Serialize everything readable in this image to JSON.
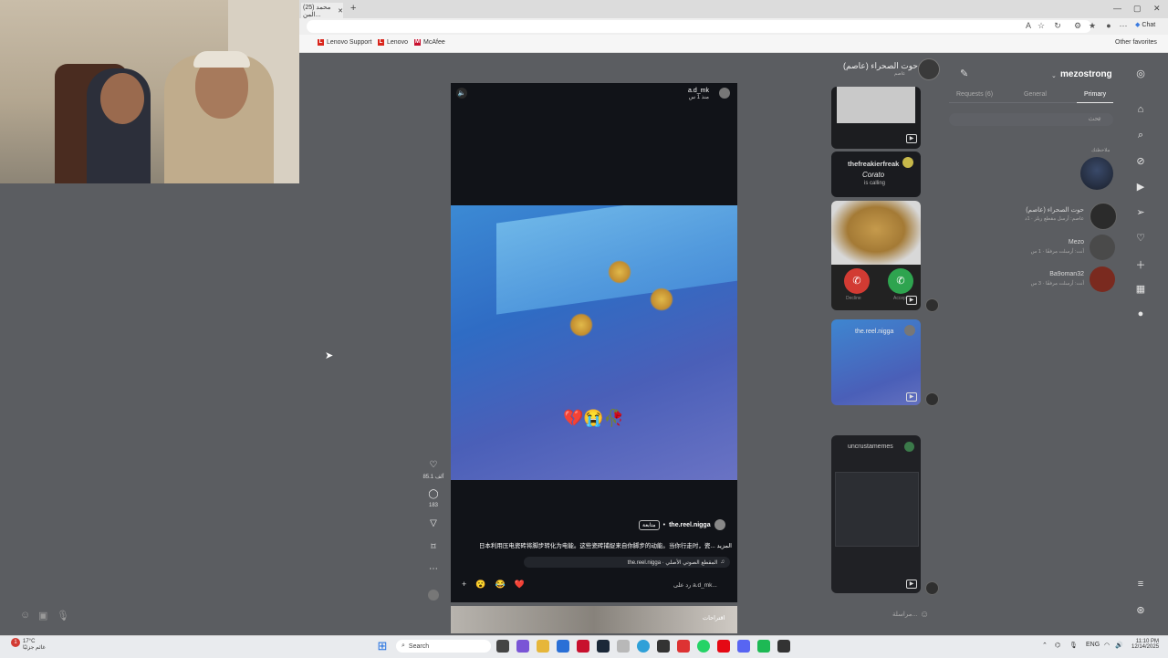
{
  "browser": {
    "tab_title": "(25) محمد المن...",
    "tab_close": "✕",
    "new_tab": "+",
    "window_controls": [
      "—",
      "▢",
      "✕"
    ],
    "chat_label": "Chat",
    "bookmarks": [
      {
        "label": "Lenovo Support",
        "icon": "L"
      },
      {
        "label": "Lenovo",
        "icon": "L"
      },
      {
        "label": "McAfee",
        "icon": "M"
      }
    ],
    "other_favorites": "Other favorites"
  },
  "reel": {
    "username": "a.d_mk",
    "time_ago": "منذ 1 س",
    "emoji_overlay": "💔😭🥀",
    "author": "the.reel.nigga",
    "follow_label": "متابعة",
    "caption": "日本利用压电瓷砖将脚步转化为电能。这些瓷砖捕捉来自你脚步的动能。当你行走时，瓷... المزيد",
    "audio": "the.reel.nigga · المقطع الصوتي الأصلي",
    "reply_placeholder": "رد على a.d_mk...",
    "quick_reactions": [
      "+",
      "😮",
      "😂",
      "❤️"
    ],
    "next_label": "اقتراحات",
    "likes": "85.1 ألف",
    "comments": "183"
  },
  "conversation": {
    "name": "حوت الصحراء (عاصم)",
    "sub": "عاصم",
    "bubble2_user": "thefreakierfreak",
    "bubble2_title": "Corato",
    "bubble2_sub": "is calling",
    "call_decline": "Decline",
    "call_accept": "Accept",
    "bubble4_user": "the.reel.nigga",
    "bubble5_user": "uncrustamemes",
    "message_placeholder": "مراسلة..."
  },
  "dm": {
    "username": "mezostrong",
    "tabs": [
      "Requests (6)",
      "General",
      "Primary"
    ],
    "search_placeholder": "بحث",
    "note_label": "ملاحظتك",
    "items": [
      {
        "name": "حوت الصحراء (عاصم)",
        "sub": "عاصم: أرسل مقطع ريلز · 1د",
        "avatar_color": "#2b2b2b"
      },
      {
        "name": "Mezo",
        "sub": "أنت: أرسلت مرفقًا · 1 س",
        "avatar_color": "#4a4a4a"
      },
      {
        "name": "Ba9oman32",
        "sub": "أنت: أرسلت مرفقًا · 3 س",
        "avatar_color": "#7a2a1f"
      }
    ]
  },
  "taskbar": {
    "weather_temp": "17°C",
    "weather_desc": "غائم جزئيًا",
    "search_label": "Search",
    "lang": "ENG",
    "time": "11:10 PM",
    "date": "12/14/2025",
    "notif_count": "1"
  },
  "colors": {
    "page_bg": "#5b5d61",
    "reel_bg": "#111318",
    "heart": "#e1306c",
    "accept": "#2ea44f",
    "decline": "#d23b33"
  }
}
